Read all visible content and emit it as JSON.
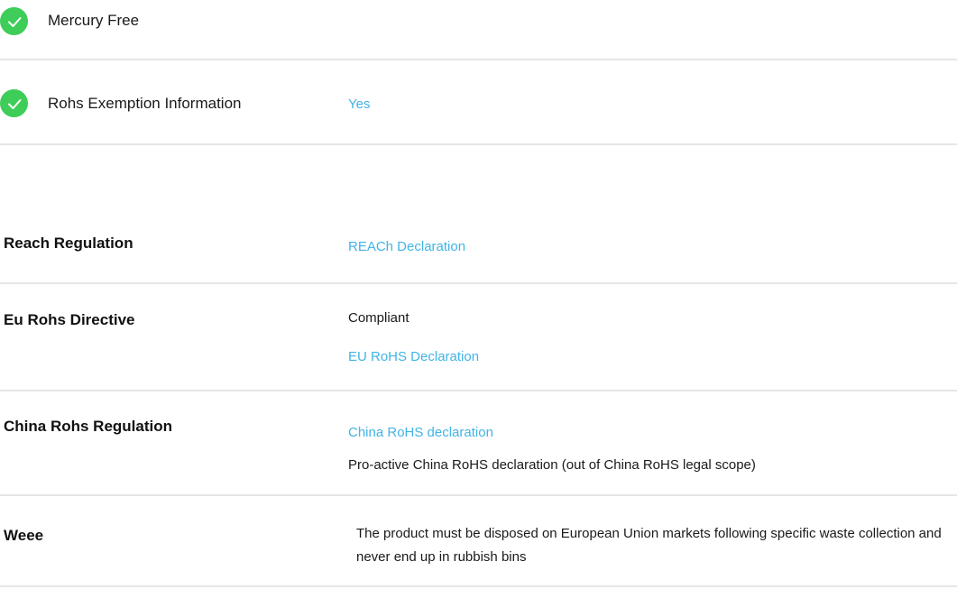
{
  "icons": {
    "check": "check-circle-icon",
    "check_color": "#3dcd58"
  },
  "colors": {
    "link": "#42b4e6",
    "divider": "#e6e6e6"
  },
  "attributes": [
    {
      "label": "Mercury Free",
      "value": ""
    },
    {
      "label": "Rohs Exemption Information",
      "value": "Yes"
    }
  ],
  "reach": {
    "label": "Reach Regulation",
    "link": "REACh Declaration"
  },
  "eu_rohs": {
    "label": "Eu Rohs Directive",
    "status": "Compliant",
    "link": "EU RoHS Declaration"
  },
  "china_rohs": {
    "label": "China Rohs Regulation",
    "link": "China RoHS declaration",
    "note": "Pro-active China RoHS declaration (out of China RoHS legal scope)"
  },
  "weee": {
    "label": "Weee",
    "text": "The product must be disposed on European Union markets following specific waste collection and never end up in rubbish bins"
  }
}
